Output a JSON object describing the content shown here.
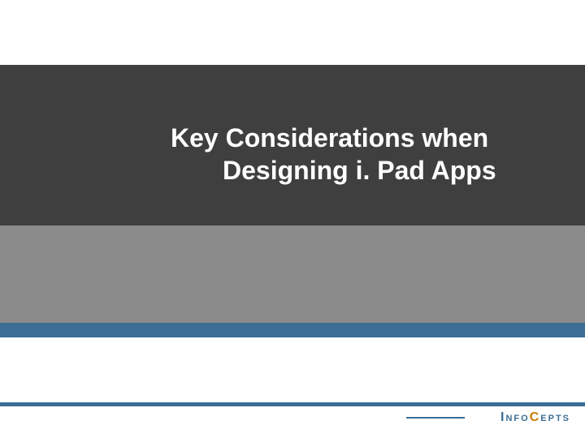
{
  "slide": {
    "title_line1": "Key Considerations when",
    "title_line2": "Designing i. Pad Apps"
  },
  "brand": {
    "logo_text_full": "InfoCepts",
    "logo_part1": "Info",
    "logo_part2_accent": "C",
    "logo_part3": "epts"
  },
  "colors": {
    "dark": "#3f3f3f",
    "grey": "#8b8b8b",
    "accent_blue": "#3a6e95",
    "accent_orange": "#cc7a00",
    "white": "#ffffff"
  }
}
